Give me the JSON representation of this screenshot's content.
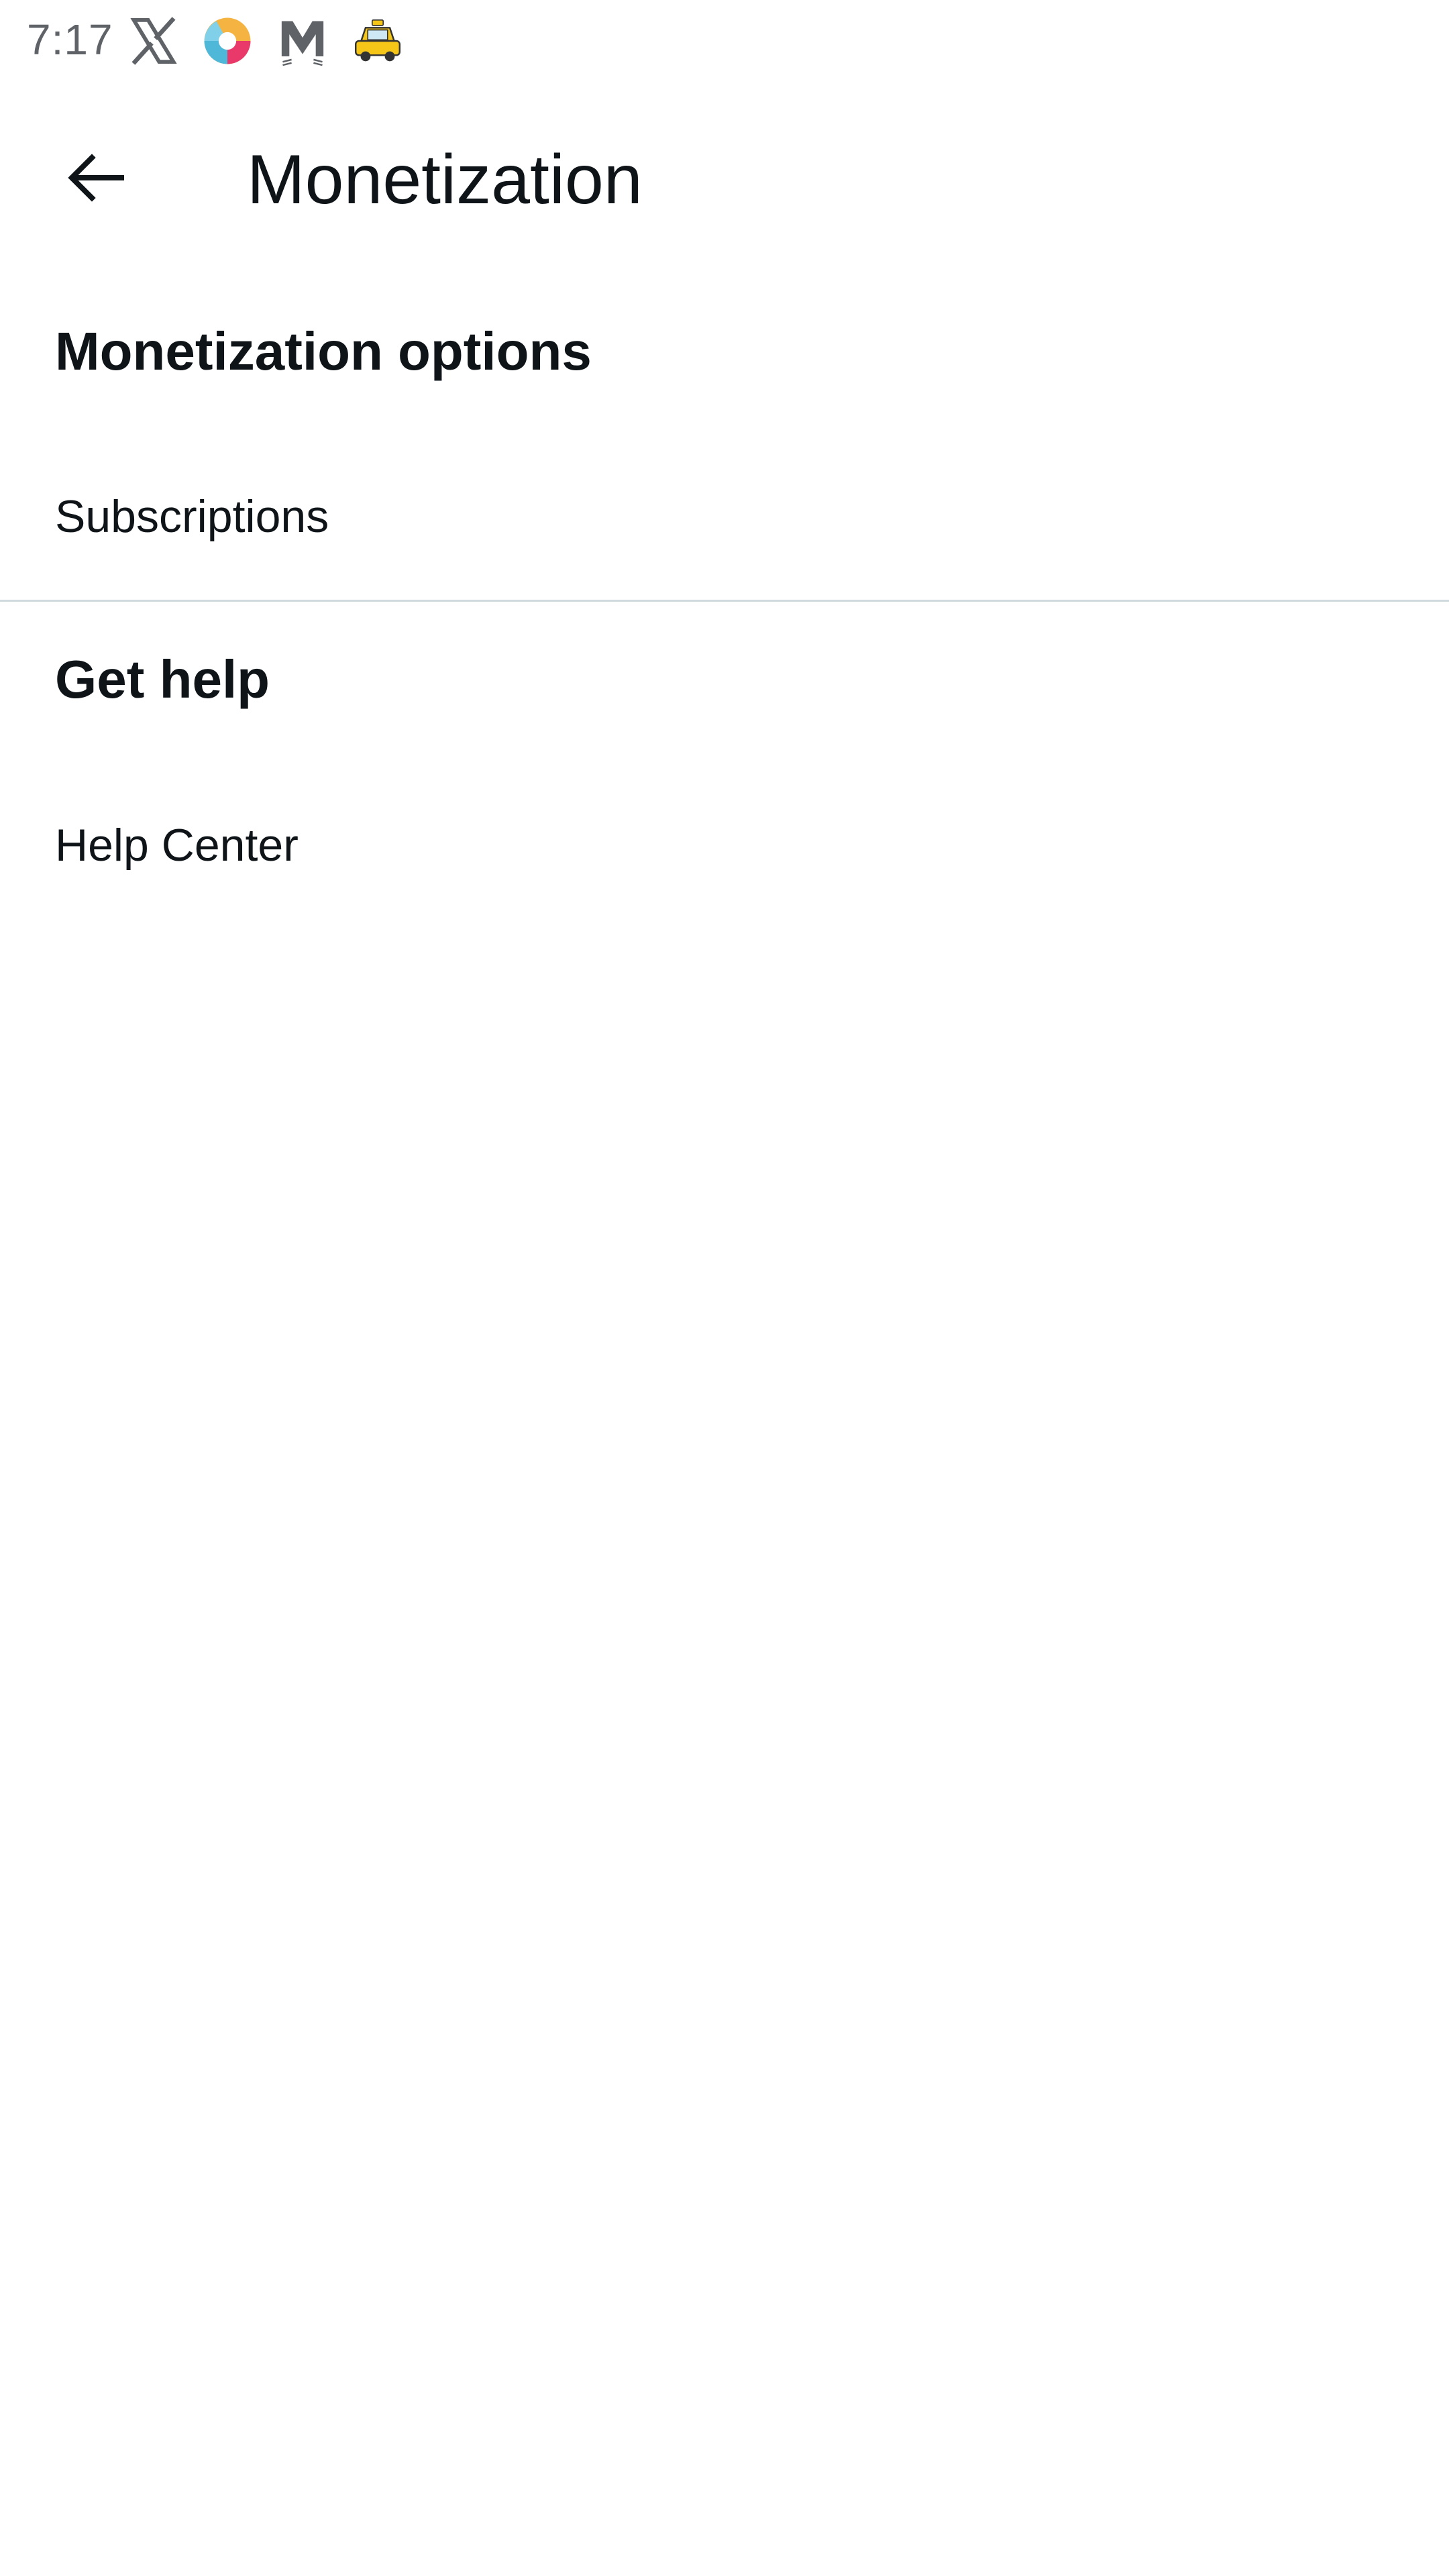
{
  "status_bar": {
    "time": "7:17",
    "icons": [
      "x-logo-icon",
      "colorful-circle-app-icon",
      "mail-cat-app-icon",
      "taxi-car-app-icon"
    ]
  },
  "app_bar": {
    "back_icon": "arrow-left-icon",
    "title": "Monetization"
  },
  "sections": [
    {
      "heading": "Monetization options",
      "items": [
        {
          "label": "Subscriptions"
        }
      ]
    },
    {
      "heading": "Get help",
      "items": [
        {
          "label": "Help Center"
        }
      ]
    }
  ],
  "colors": {
    "text_primary": "#0f1419",
    "divider": "#cfd9de",
    "status_text": "#5f6368",
    "background": "#ffffff"
  }
}
